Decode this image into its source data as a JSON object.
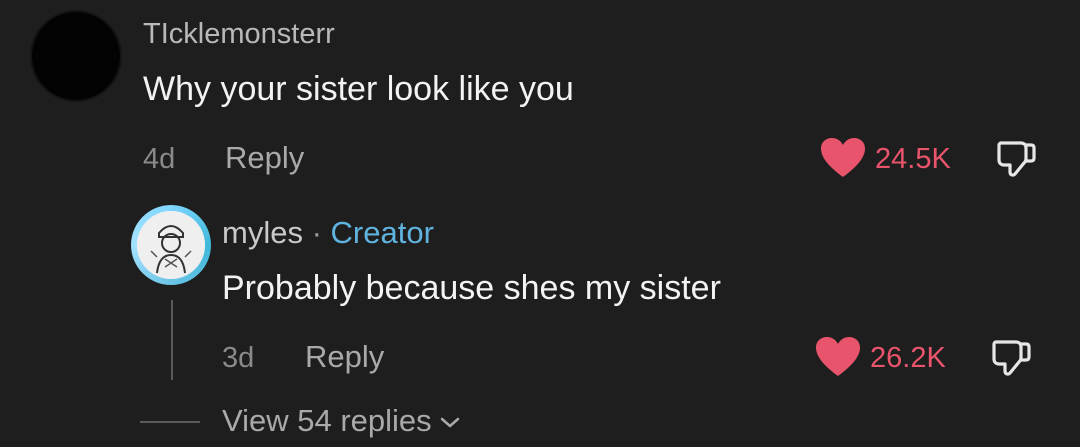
{
  "comment": {
    "username": "TIcklemonsterr",
    "text": "Why your sister look like you",
    "time": "4d",
    "reply_label": "Reply",
    "likes": "24.5K"
  },
  "reply": {
    "username": "myles",
    "separator": "·",
    "creator_label": "Creator",
    "text": "Probably because shes my sister",
    "time": "3d",
    "reply_label": "Reply",
    "likes": "26.2K"
  },
  "view_replies_label": "View 54 replies",
  "colors": {
    "background": "#1e1e1e",
    "like_red": "#e8546b",
    "creator_blue": "#5fb3de"
  },
  "icons": [
    "heart-icon",
    "dislike-icon",
    "chevron-down-icon"
  ]
}
